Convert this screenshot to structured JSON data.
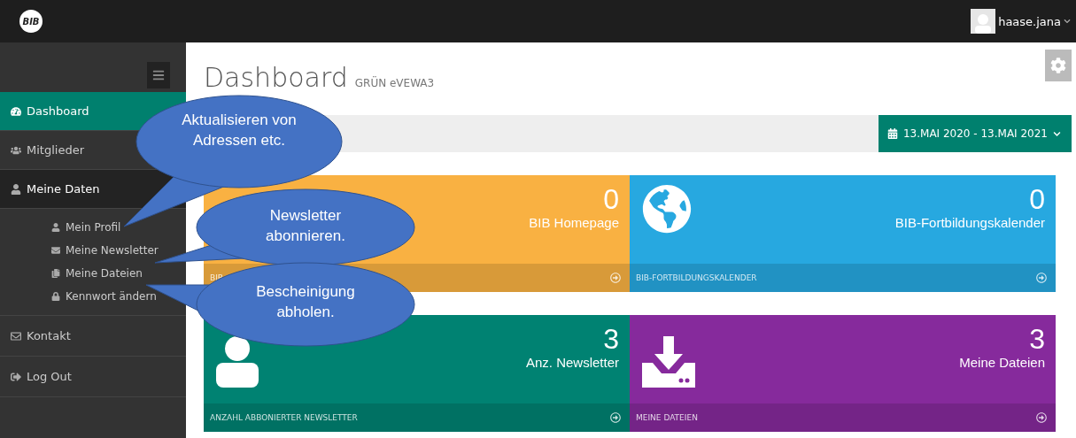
{
  "topbar": {
    "logo": "BIB",
    "user": "haase.jana"
  },
  "sidebar": {
    "items": [
      {
        "kind": "item",
        "label": "Dashboard",
        "selected": true
      },
      {
        "kind": "item",
        "label": "Mitglieder",
        "selected": false
      },
      {
        "kind": "group",
        "label": "Meine Daten",
        "selected": false,
        "expanded": true,
        "children": [
          {
            "kind": "subitem",
            "label": "Mein Profil",
            "selected": false
          },
          {
            "kind": "subitem",
            "label": "Meine Newsletter",
            "selected": false
          },
          {
            "kind": "subitem",
            "label": "Meine Dateien",
            "selected": false
          },
          {
            "kind": "subitem",
            "label": "Kennwort ändern",
            "selected": false
          }
        ]
      },
      {
        "kind": "item",
        "label": "Kontakt",
        "selected": false
      },
      {
        "kind": "item",
        "label": "Log Out",
        "selected": false
      }
    ]
  },
  "header": {
    "title": "Dashboard",
    "subtitle": "GRÜN eVEWA3",
    "date_range": "13.MAI 2020 - 13.MAI 2021"
  },
  "tiles": [
    {
      "count": "0",
      "label": "BIB Homepage",
      "footer": "BIB",
      "color": "#f9b142"
    },
    {
      "count": "0",
      "label": "BIB-Fortbildungskalender",
      "footer": "BIB-FORTBILDUNGSKALENDER",
      "color": "#27a8e0"
    },
    {
      "count": "3",
      "label": "Anz. Newsletter",
      "footer": "ANZAHL ABBONIERTER NEWSLETTER",
      "color": "#008272"
    },
    {
      "count": "3",
      "label": "Meine Dateien",
      "footer": "MEINE DATEIEN",
      "color": "#862a9c"
    }
  ],
  "callouts": [
    {
      "text": "Aktualisieren von Adressen etc."
    },
    {
      "text": "Newsletter abonnieren."
    },
    {
      "text": "Bescheinigung abholen."
    }
  ]
}
